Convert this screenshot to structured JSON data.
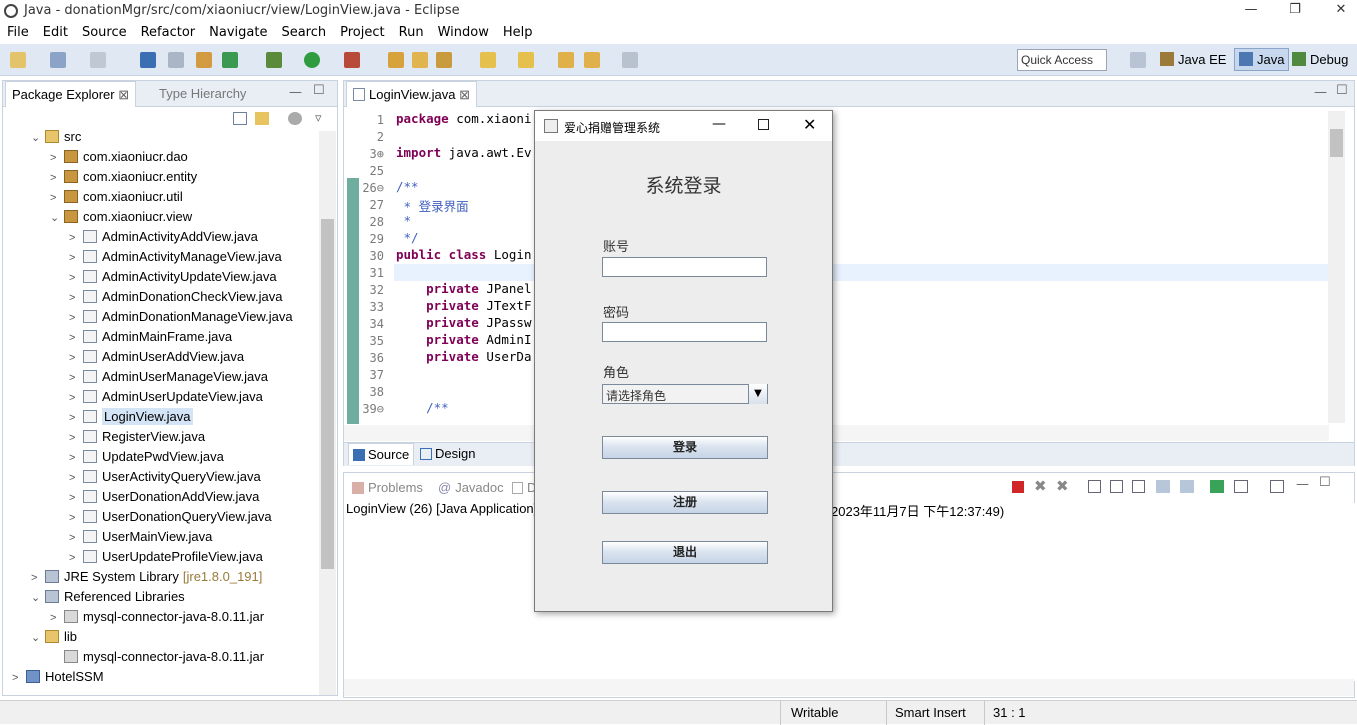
{
  "window": {
    "title": "Java - donationMgr/src/com/xiaoniucr/view/LoginView.java - Eclipse",
    "minimize": "—",
    "restore": "❐",
    "close": "✕"
  },
  "menu": [
    "File",
    "Edit",
    "Source",
    "Refactor",
    "Navigate",
    "Search",
    "Project",
    "Run",
    "Window",
    "Help"
  ],
  "toolbar": {
    "quick_access": "Quick Access",
    "perspectives": [
      "Java EE",
      "Java",
      "Debug"
    ]
  },
  "left_pane": {
    "tabs": [
      "Package Explorer",
      "Type Hierarchy"
    ],
    "tree": [
      {
        "label": "src",
        "indent": 2,
        "arrow": "⌄",
        "icon": "folder"
      },
      {
        "label": "com.xiaoniucr.dao",
        "indent": 3,
        "arrow": ">",
        "icon": "pkg"
      },
      {
        "label": "com.xiaoniucr.entity",
        "indent": 3,
        "arrow": ">",
        "icon": "pkg"
      },
      {
        "label": "com.xiaoniucr.util",
        "indent": 3,
        "arrow": ">",
        "icon": "pkg"
      },
      {
        "label": "com.xiaoniucr.view",
        "indent": 3,
        "arrow": "⌄",
        "icon": "pkg"
      },
      {
        "label": "AdminActivityAddView.java",
        "indent": 4,
        "arrow": ">",
        "icon": "java"
      },
      {
        "label": "AdminActivityManageView.java",
        "indent": 4,
        "arrow": ">",
        "icon": "java"
      },
      {
        "label": "AdminActivityUpdateView.java",
        "indent": 4,
        "arrow": ">",
        "icon": "java"
      },
      {
        "label": "AdminDonationCheckView.java",
        "indent": 4,
        "arrow": ">",
        "icon": "java"
      },
      {
        "label": "AdminDonationManageView.java",
        "indent": 4,
        "arrow": ">",
        "icon": "java"
      },
      {
        "label": "AdminMainFrame.java",
        "indent": 4,
        "arrow": ">",
        "icon": "java"
      },
      {
        "label": "AdminUserAddView.java",
        "indent": 4,
        "arrow": ">",
        "icon": "java"
      },
      {
        "label": "AdminUserManageView.java",
        "indent": 4,
        "arrow": ">",
        "icon": "java"
      },
      {
        "label": "AdminUserUpdateView.java",
        "indent": 4,
        "arrow": ">",
        "icon": "java"
      },
      {
        "label": "LoginView.java",
        "indent": 4,
        "arrow": ">",
        "icon": "java",
        "selected": true
      },
      {
        "label": "RegisterView.java",
        "indent": 4,
        "arrow": ">",
        "icon": "java"
      },
      {
        "label": "UpdatePwdView.java",
        "indent": 4,
        "arrow": ">",
        "icon": "java"
      },
      {
        "label": "UserActivityQueryView.java",
        "indent": 4,
        "arrow": ">",
        "icon": "java"
      },
      {
        "label": "UserDonationAddView.java",
        "indent": 4,
        "arrow": ">",
        "icon": "java"
      },
      {
        "label": "UserDonationQueryView.java",
        "indent": 4,
        "arrow": ">",
        "icon": "java"
      },
      {
        "label": "UserMainView.java",
        "indent": 4,
        "arrow": ">",
        "icon": "java"
      },
      {
        "label": "UserUpdateProfileView.java",
        "indent": 4,
        "arrow": ">",
        "icon": "java"
      },
      {
        "label": "JRE System Library",
        "suffix": "[jre1.8.0_191]",
        "indent": 2,
        "arrow": ">",
        "icon": "lib"
      },
      {
        "label": "Referenced Libraries",
        "indent": 2,
        "arrow": "⌄",
        "icon": "lib"
      },
      {
        "label": "mysql-connector-java-8.0.11.jar",
        "indent": 3,
        "arrow": ">",
        "icon": "jar"
      },
      {
        "label": "lib",
        "indent": 2,
        "arrow": "⌄",
        "icon": "folder"
      },
      {
        "label": "mysql-connector-java-8.0.11.jar",
        "indent": 3,
        "arrow": "",
        "icon": "jar"
      },
      {
        "label": "HotelSSM",
        "indent": 1,
        "arrow": ">",
        "icon": "proj"
      }
    ]
  },
  "editor": {
    "tab": "LoginView.java",
    "lines": [
      {
        "n": "1",
        "text": "package com.xiaoni"
      },
      {
        "n": "2",
        "text": ""
      },
      {
        "n": "3⊕",
        "text": "import java.awt.Ev"
      },
      {
        "n": "25",
        "text": ""
      },
      {
        "n": "26⊖",
        "text": "/**"
      },
      {
        "n": "27",
        "text": " * 登录界面"
      },
      {
        "n": "28",
        "text": " *"
      },
      {
        "n": "29",
        "text": " */"
      },
      {
        "n": "30",
        "text": "public class Login"
      },
      {
        "n": "31",
        "text": ""
      },
      {
        "n": "32",
        "text": "    private JPanel"
      },
      {
        "n": "33",
        "text": "    private JTextF"
      },
      {
        "n": "34",
        "text": "    private JPassw"
      },
      {
        "n": "35",
        "text": "    private AdminI"
      },
      {
        "n": "36",
        "text": "    private UserDa"
      },
      {
        "n": "37",
        "text": ""
      },
      {
        "n": "38",
        "text": ""
      },
      {
        "n": "39⊖",
        "text": "    /**"
      }
    ],
    "bottom_tabs": [
      "Source",
      "Design"
    ]
  },
  "console": {
    "tabs": [
      "Problems",
      "Javadoc",
      "D"
    ],
    "launch": "LoginView (26) [Java Application]",
    "time": "2023年11月7日 下午12:37:49)"
  },
  "dialog": {
    "title": "爱心捐赠管理系统",
    "heading": "系统登录",
    "account_label": "账号",
    "password_label": "密码",
    "role_label": "角色",
    "role_placeholder": "请选择角色",
    "login_button": "登录",
    "register_button": "注册",
    "exit_button": "退出"
  },
  "status": {
    "writable": "Writable",
    "insert": "Smart Insert",
    "position": "31 : 1"
  }
}
